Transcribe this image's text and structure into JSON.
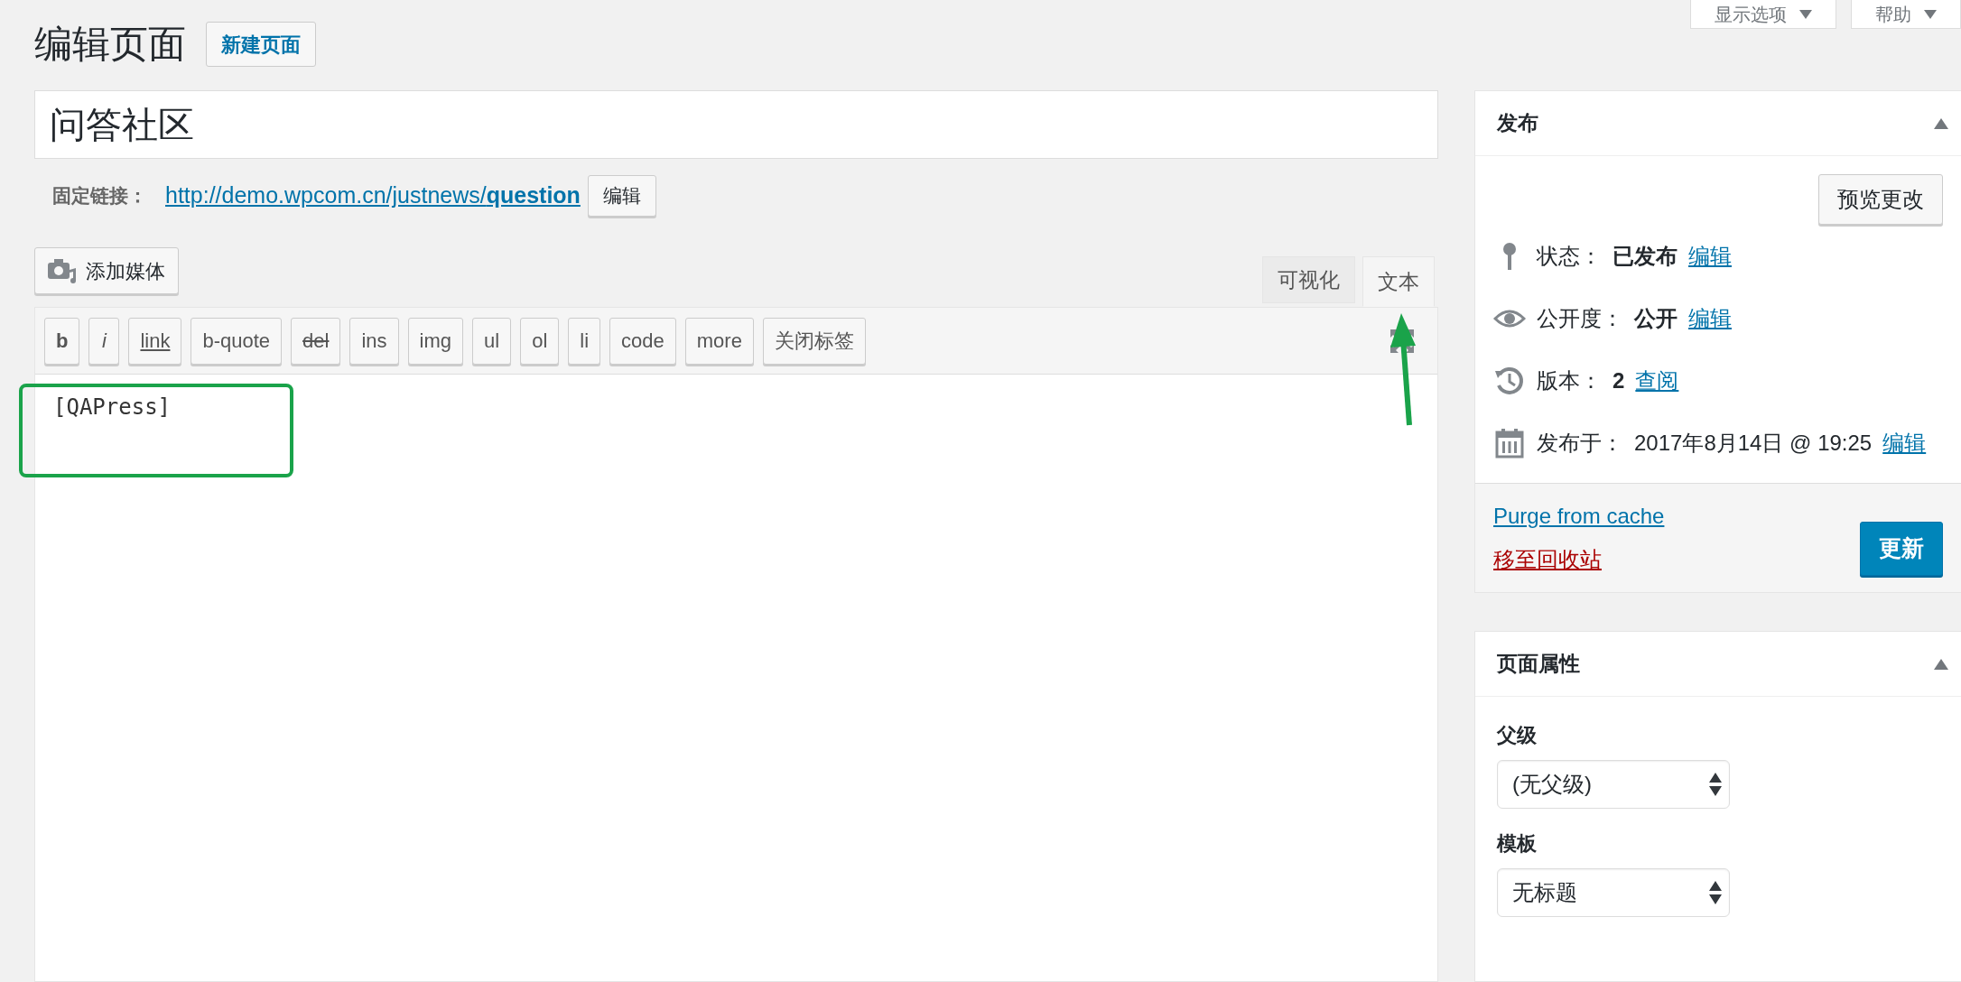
{
  "header": {
    "page_title": "编辑页面",
    "add_new_button": "新建页面",
    "screen_buttons": [
      {
        "label": "显示选项"
      },
      {
        "label": "帮助"
      }
    ]
  },
  "title_field": {
    "value": "问答社区"
  },
  "permalink": {
    "label": "固定链接：",
    "url": "http://demo.wpcom.cn/justnews/**question**",
    "edit_button": "编辑"
  },
  "editor": {
    "add_media_button": "添加媒体",
    "tabs": [
      {
        "label": "可视化",
        "selected": false
      },
      {
        "label": "文本",
        "selected": true
      }
    ],
    "quicktags": [
      {
        "label": "b",
        "kind": "bold"
      },
      {
        "label": "i",
        "kind": "italic"
      },
      {
        "label": "link",
        "kind": "underline"
      },
      {
        "label": "b-quote",
        "kind": "plain"
      },
      {
        "label": "del",
        "kind": "strike"
      },
      {
        "label": "ins",
        "kind": "plain"
      },
      {
        "label": "img",
        "kind": "plain"
      },
      {
        "label": "ul",
        "kind": "plain"
      },
      {
        "label": "ol",
        "kind": "plain"
      },
      {
        "label": "li",
        "kind": "plain"
      },
      {
        "label": "code",
        "kind": "plain"
      },
      {
        "label": "more",
        "kind": "plain"
      },
      {
        "label": "关闭标签",
        "kind": "plain"
      }
    ],
    "content": "[QAPress]"
  },
  "publish": {
    "title": "发布",
    "preview_button": "预览更改",
    "rows": [
      {
        "kind": "status",
        "label": "状态：",
        "value": "已发布",
        "link": "编辑"
      },
      {
        "kind": "visibility",
        "label": "公开度：",
        "value": "公开",
        "link": "编辑"
      },
      {
        "kind": "revisions",
        "label": "版本：",
        "value": "2",
        "link": "查阅"
      },
      {
        "kind": "date",
        "label": "发布于：",
        "value": "2017年8月14日 @ 19:25",
        "link": "编辑"
      }
    ],
    "purge_link": "Purge from cache",
    "trash_link": "移至回收站",
    "update_button": "更新"
  },
  "page_attributes": {
    "title": "页面属性",
    "fields": [
      {
        "label": "父级",
        "value": "(无父级)"
      },
      {
        "label": "模板",
        "value": "无标题"
      }
    ]
  }
}
